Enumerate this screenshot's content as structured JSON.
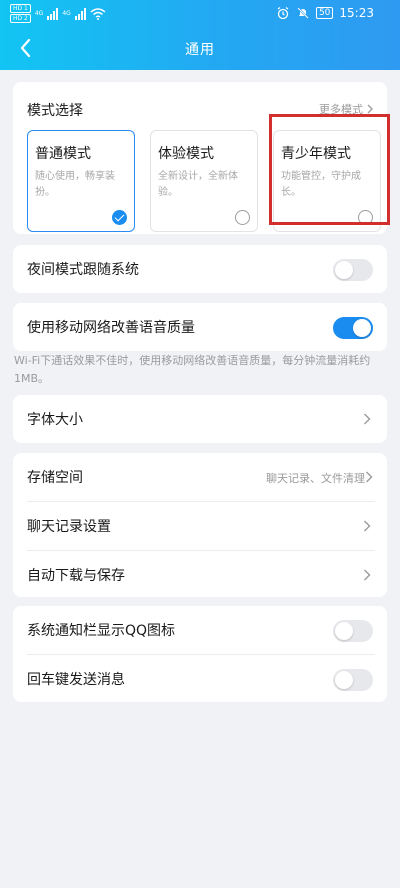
{
  "status_bar": {
    "left_sim1": "HD 1",
    "left_sim2": "HD 2",
    "network_1": "4G",
    "network_2": "4G",
    "battery": "50",
    "time": "15:23"
  },
  "header": {
    "title": "通用"
  },
  "mode_section": {
    "title": "模式选择",
    "more_label": "更多模式",
    "modes": [
      {
        "title": "普通模式",
        "desc": "随心使用，畅享装扮。",
        "selected": true
      },
      {
        "title": "体验模式",
        "desc": "全新设计，全新体验。",
        "selected": false
      },
      {
        "title": "青少年模式",
        "desc": "功能管控，守护成长。",
        "selected": false
      }
    ]
  },
  "night_mode": {
    "label": "夜间模式跟随系统",
    "enabled": false
  },
  "mobile_voice": {
    "label": "使用移动网络改善语音质量",
    "enabled": true,
    "note": "Wi-Fi下通话效果不佳时，使用移动网络改善语音质量，每分钟流量消耗约1MB。"
  },
  "font_size": {
    "label": "字体大小"
  },
  "storage_group": {
    "storage_label": "存储空间",
    "storage_value": "聊天记录、文件清理",
    "chat_settings_label": "聊天记录设置",
    "auto_download_label": "自动下载与保存"
  },
  "notify_group": {
    "qq_icon_label": "系统通知栏显示QQ图标",
    "qq_icon_enabled": false,
    "enter_send_label": "回车键发送消息",
    "enter_send_enabled": false
  },
  "colors": {
    "accent": "#1a8cf0",
    "highlight": "#d32e2e"
  }
}
